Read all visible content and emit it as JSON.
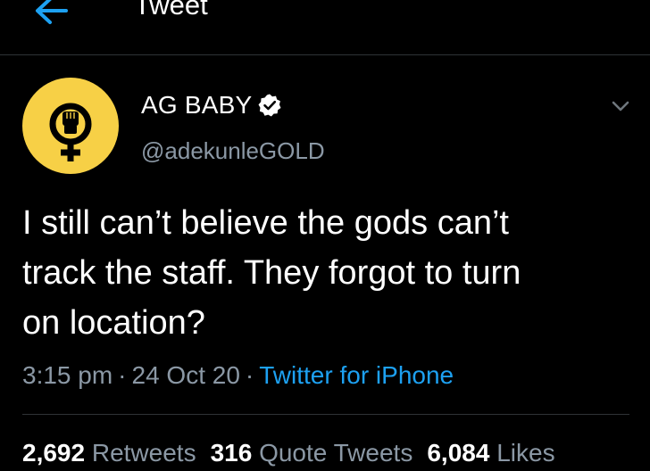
{
  "header": {
    "title": "Tweet",
    "back_icon": "back-arrow-icon",
    "accent_color": "#1da1f2"
  },
  "author": {
    "display_name": "AG BABY",
    "handle": "@adekunleGOLD",
    "verified_icon": "verified-badge-icon",
    "avatar_bg": "#f7d046"
  },
  "tweet": {
    "lines": [
      "I still can’t believe the gods can’t",
      "track the staff. They forgot to turn",
      "on location?"
    ],
    "time": "3:15 pm",
    "date": "24 Oct 20",
    "source": "Twitter for iPhone",
    "separator": "·"
  },
  "stats": {
    "retweets_count": "2,692",
    "retweets_label": "Retweets",
    "quotes_count": "316",
    "quotes_label": "Quote Tweets",
    "likes_count": "6,084",
    "likes_label": "Likes"
  },
  "colors": {
    "background": "#000000",
    "secondary_text": "#8b98a5",
    "link": "#1da1f2",
    "divider": "#2f3336"
  }
}
